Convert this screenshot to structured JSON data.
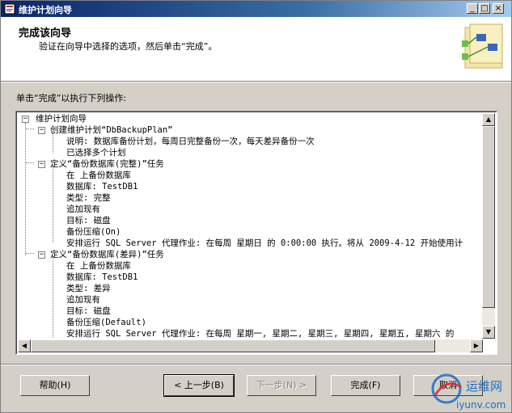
{
  "window": {
    "title": "维护计划向导"
  },
  "titlebar_buttons": {
    "minimize": "_",
    "maximize": "□",
    "close": "×"
  },
  "header": {
    "title": "完成该向导",
    "subtitle": "验证在向导中选择的选项，然后单击“完成”。"
  },
  "intro": "单击“完成”以执行下列操作:",
  "tree": {
    "root": "维护计划向导",
    "plan": {
      "label": "创建维护计划“DbBackupPlan”",
      "children": [
        "说明: 数据库备份计划，每周日完整备份一次，每天差异备份一次",
        "已选择多个计划"
      ]
    },
    "task_full": {
      "label": "定义“备份数据库(完整)”任务",
      "children": [
        "在  上备份数据库",
        "数据库: TestDB1",
        "类型: 完整",
        "追加现有",
        "目标: 磁盘",
        "备份压缩(On)",
        "安排运行 SQL Server 代理作业: 在每周 星期日 的 0:00:00 执行。将从 2009-4-12 开始使用计"
      ]
    },
    "task_diff": {
      "label": "定义“备份数据库(差异)”任务",
      "children": [
        "在  上备份数据库",
        "数据库: TestDB1",
        "类型: 差异",
        "追加现有",
        "目标: 磁盘",
        "备份压缩(Default)",
        "安排运行 SQL Server 代理作业: 在每周 星期一, 星期二, 星期三, 星期四, 星期五, 星期六 的"
      ]
    }
  },
  "buttons": {
    "help": "帮助(H)",
    "back": "< 上一步(B)",
    "next": "下一步(N) >",
    "finish": "完成(F)",
    "cancel": "取消"
  },
  "watermark": {
    "site": "运维网",
    "url": "iyunv.com"
  },
  "colors": {
    "title_bar_start": "#0a246a",
    "title_bar_end": "#a6caf0",
    "face": "#d4d0c8",
    "watermark_blue": "#1a6fc4"
  }
}
